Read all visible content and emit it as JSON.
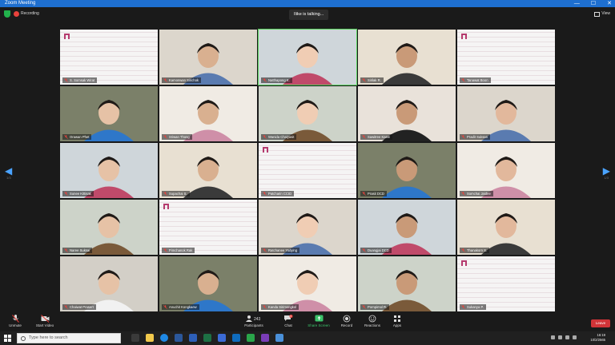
{
  "window": {
    "title": "Zoom Meeting",
    "minimize": "—",
    "maximize": "☐",
    "close": "✕"
  },
  "topbar": {
    "recording_label": "Recording",
    "talking": "Ilike is talking...",
    "view_label": "View"
  },
  "pager": {
    "left_arrow": "◀",
    "right_arrow": "▶",
    "left_page": "1/3",
    "right_page": "1/3"
  },
  "participants": [
    {
      "name": "S. Somsak Wirat",
      "type": "brand"
    },
    {
      "name": "Kamonwan Sirichok",
      "type": "person"
    },
    {
      "name": "Natthapong K.",
      "type": "person"
    },
    {
      "name": "Sirilak R.",
      "type": "person"
    },
    {
      "name": "Tanawat Boon",
      "type": "brand"
    },
    {
      "name": "Orawan Phet",
      "type": "person"
    },
    {
      "name": "Sriwan Thong",
      "type": "person"
    },
    {
      "name": "Wanida Chaiyasit",
      "type": "person"
    },
    {
      "name": "Sawitree Kaew",
      "type": "person"
    },
    {
      "name": "Pradit Suksan",
      "type": "person"
    },
    {
      "name": "Sunee Kittisak",
      "type": "person"
    },
    {
      "name": "Supachai S.",
      "type": "person"
    },
    {
      "name": "Patcharin CCID",
      "type": "brand"
    },
    {
      "name": "Prasit DCD",
      "type": "person"
    },
    {
      "name": "Somchai Jaidee",
      "type": "person"
    },
    {
      "name": "Naree Suksai",
      "type": "person"
    },
    {
      "name": "Pimchanok Rak",
      "type": "brand"
    },
    {
      "name": "Ratchanee Yodying",
      "type": "person"
    },
    {
      "name": "Duangjai DCD",
      "type": "person"
    },
    {
      "name": "Thanakorn S.",
      "type": "person"
    },
    {
      "name": "Chaiwat Prasert",
      "type": "person"
    },
    {
      "name": "Anuchit Kongkaew",
      "type": "person"
    },
    {
      "name": "Kanda Sirimongkol",
      "type": "person"
    },
    {
      "name": "Pornpimol R.",
      "type": "person"
    },
    {
      "name": "Sukanya P.",
      "type": "brand"
    }
  ],
  "toolbar": {
    "unmute": "Unmute",
    "start_video": "Start Video",
    "participants": "Participants",
    "participants_count": "243",
    "chat": "Chat",
    "chat_badge": "5",
    "share_screen": "Share Screen",
    "record": "Record",
    "reactions": "Reactions",
    "apps": "Apps",
    "leave": "Leave"
  },
  "taskbar": {
    "search_placeholder": "Type here to search",
    "time": "16:19",
    "date": "10/2/2565"
  },
  "colors": {
    "accent": "#1e6fd0",
    "leave": "#d13438",
    "share": "#3cc36b",
    "brand": "#b53a6e"
  }
}
